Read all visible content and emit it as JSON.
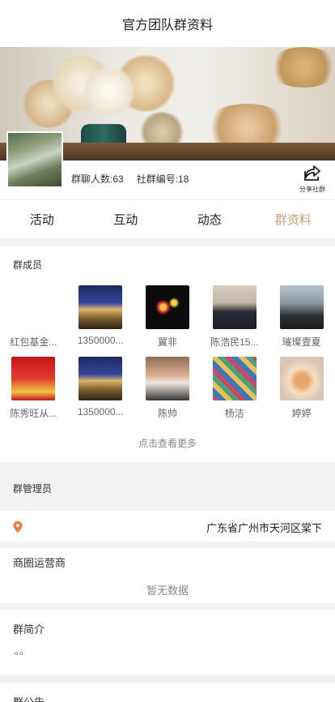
{
  "header": {
    "title": "官方团队群资料"
  },
  "group": {
    "member_count_label": "群聊人数:63",
    "group_id_label": "社群编号:18",
    "share_label": "分享社群"
  },
  "tabs": [
    {
      "label": "活动",
      "active": false
    },
    {
      "label": "互动",
      "active": false
    },
    {
      "label": "动态",
      "active": false
    },
    {
      "label": "群资料",
      "active": true
    }
  ],
  "members": {
    "title": "群成员",
    "items": [
      {
        "name": "红包基金...",
        "avatar": "none"
      },
      {
        "name": "1350000...",
        "avatar": "building"
      },
      {
        "name": "翼非",
        "avatar": "fireworks"
      },
      {
        "name": "陈浩民15...",
        "avatar": "suit"
      },
      {
        "name": "璀璨壹夏",
        "avatar": "camera"
      },
      {
        "name": "陈秀旺从...",
        "avatar": "red-banner"
      },
      {
        "name": "1350000...",
        "avatar": "building"
      },
      {
        "name": "陈帅",
        "avatar": "man"
      },
      {
        "name": "杨洁",
        "avatar": "quilt"
      },
      {
        "name": "婷婷",
        "avatar": "cat"
      }
    ],
    "more_label": "点击查看更多"
  },
  "admin": {
    "title": "群管理员",
    "address": "广东省广州市天河区棠下"
  },
  "business": {
    "title": "商圈运营商",
    "empty_label": "暂无数据"
  },
  "intro": {
    "title": "群简介",
    "body": "。。"
  },
  "notice": {
    "title": "群公告"
  },
  "colors": {
    "active_tab": "#c9a07a",
    "pin": "#f07b3f"
  }
}
